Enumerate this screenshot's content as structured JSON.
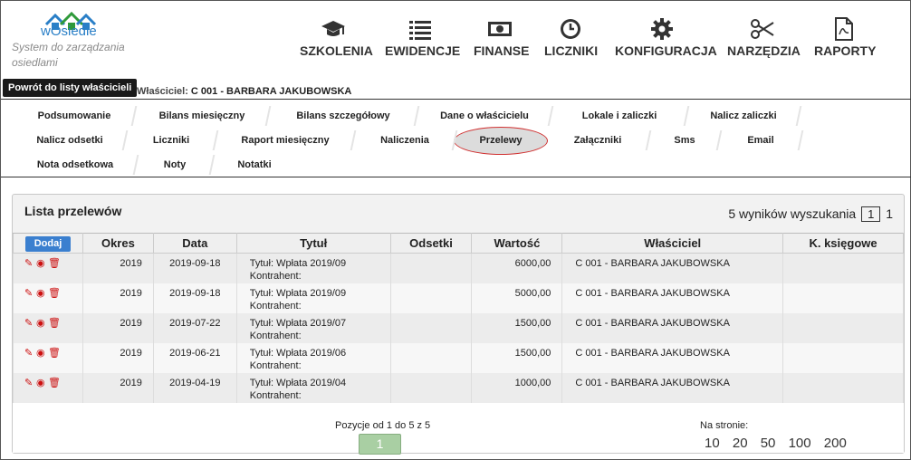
{
  "header": {
    "logo_text": "wOsiedle",
    "tagline": "System do zarządzania osiedlami",
    "nav": [
      {
        "label": "SZKOLENIA",
        "icon": "graduation-cap-icon"
      },
      {
        "label": "EWIDENCJE",
        "icon": "list-icon"
      },
      {
        "label": "FINANSE",
        "icon": "money-icon"
      },
      {
        "label": "LICZNIKI",
        "icon": "clock-icon"
      },
      {
        "label": "KONFIGURACJA",
        "icon": "gear-icon"
      },
      {
        "label": "NARZĘDZIA",
        "icon": "scissors-icon"
      },
      {
        "label": "RAPORTY",
        "icon": "pdf-file-icon"
      }
    ]
  },
  "owner_bar": {
    "back_label": "Powrót do listy właścicieli",
    "owner_key": "Właściciel:",
    "owner_value": "C 001 - BARBARA JAKUBOWSKA"
  },
  "tabs": {
    "row1": [
      "Podsumowanie",
      "Bilans miesięczny",
      "Bilans szczegółowy",
      "Dane o właścicielu",
      "Lokale i zaliczki",
      "Nalicz zaliczki"
    ],
    "row2": [
      "Nalicz odsetki",
      "Liczniki",
      "Raport miesięczny",
      "Naliczenia",
      "Przelewy",
      "Załączniki",
      "Sms",
      "Email"
    ],
    "row3": [
      "Nota odsetkowa",
      "Noty",
      "Notatki"
    ],
    "active": "Przelewy"
  },
  "panel": {
    "title": "Lista przelewów",
    "results_text": "5 wyników wyszukania",
    "page_box": "1",
    "page_total": "1",
    "add_label": "Dodaj",
    "columns": [
      "Okres",
      "Data",
      "Tytuł",
      "Odsetki",
      "Wartość",
      "Właściciel",
      "K. księgowe"
    ],
    "rows": [
      {
        "okres": "2019",
        "data": "2019-09-18",
        "tytul": "Tytuł: Wpłata 2019/09",
        "kontrahent": "Kontrahent:",
        "odsetki": "",
        "wartosc": "6000,00",
        "wlasciciel": "C 001 - BARBARA JAKUBOWSKA",
        "k": ""
      },
      {
        "okres": "2019",
        "data": "2019-09-18",
        "tytul": "Tytuł: Wpłata 2019/09",
        "kontrahent": "Kontrahent:",
        "odsetki": "",
        "wartosc": "5000,00",
        "wlasciciel": "C 001 - BARBARA JAKUBOWSKA",
        "k": ""
      },
      {
        "okres": "2019",
        "data": "2019-07-22",
        "tytul": "Tytuł: Wpłata 2019/07",
        "kontrahent": "Kontrahent:",
        "odsetki": "",
        "wartosc": "1500,00",
        "wlasciciel": "C 001 - BARBARA JAKUBOWSKA",
        "k": ""
      },
      {
        "okres": "2019",
        "data": "2019-06-21",
        "tytul": "Tytuł: Wpłata 2019/06",
        "kontrahent": "Kontrahent:",
        "odsetki": "",
        "wartosc": "1500,00",
        "wlasciciel": "C 001 - BARBARA JAKUBOWSKA",
        "k": ""
      },
      {
        "okres": "2019",
        "data": "2019-04-19",
        "tytul": "Tytuł: Wpłata 2019/04",
        "kontrahent": "Kontrahent:",
        "odsetki": "",
        "wartosc": "1000,00",
        "wlasciciel": "C 001 - BARBARA JAKUBOWSKA",
        "k": ""
      }
    ],
    "row_actions": [
      "edit-icon",
      "view-icon",
      "delete-icon"
    ],
    "footer": {
      "positions": "Pozycje od 1 do 5 z 5",
      "current_page": "1",
      "per_page_label": "Na stronie:",
      "per_page_options": [
        "10",
        "20",
        "50",
        "100",
        "200"
      ]
    }
  },
  "colors": {
    "accent": "#3a7fcf",
    "pager": "#a9cfa3",
    "danger": "#cc1111"
  }
}
